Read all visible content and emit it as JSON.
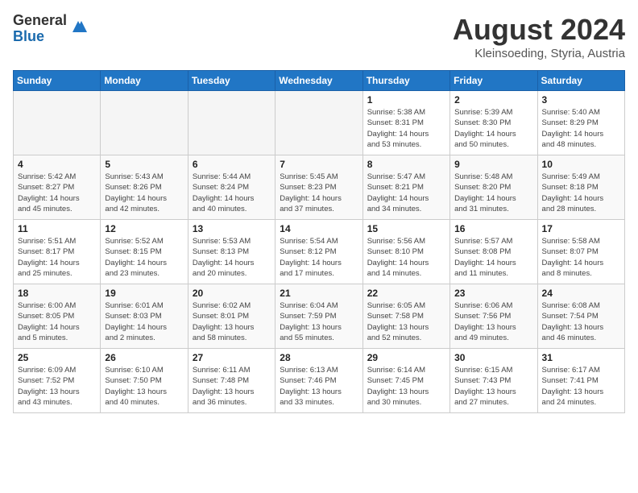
{
  "header": {
    "logo_line1": "General",
    "logo_line2": "Blue",
    "month_title": "August 2024",
    "location": "Kleinsoeding, Styria, Austria"
  },
  "days_of_week": [
    "Sunday",
    "Monday",
    "Tuesday",
    "Wednesday",
    "Thursday",
    "Friday",
    "Saturday"
  ],
  "weeks": [
    [
      {
        "day": "",
        "info": ""
      },
      {
        "day": "",
        "info": ""
      },
      {
        "day": "",
        "info": ""
      },
      {
        "day": "",
        "info": ""
      },
      {
        "day": "1",
        "info": "Sunrise: 5:38 AM\nSunset: 8:31 PM\nDaylight: 14 hours\nand 53 minutes."
      },
      {
        "day": "2",
        "info": "Sunrise: 5:39 AM\nSunset: 8:30 PM\nDaylight: 14 hours\nand 50 minutes."
      },
      {
        "day": "3",
        "info": "Sunrise: 5:40 AM\nSunset: 8:29 PM\nDaylight: 14 hours\nand 48 minutes."
      }
    ],
    [
      {
        "day": "4",
        "info": "Sunrise: 5:42 AM\nSunset: 8:27 PM\nDaylight: 14 hours\nand 45 minutes."
      },
      {
        "day": "5",
        "info": "Sunrise: 5:43 AM\nSunset: 8:26 PM\nDaylight: 14 hours\nand 42 minutes."
      },
      {
        "day": "6",
        "info": "Sunrise: 5:44 AM\nSunset: 8:24 PM\nDaylight: 14 hours\nand 40 minutes."
      },
      {
        "day": "7",
        "info": "Sunrise: 5:45 AM\nSunset: 8:23 PM\nDaylight: 14 hours\nand 37 minutes."
      },
      {
        "day": "8",
        "info": "Sunrise: 5:47 AM\nSunset: 8:21 PM\nDaylight: 14 hours\nand 34 minutes."
      },
      {
        "day": "9",
        "info": "Sunrise: 5:48 AM\nSunset: 8:20 PM\nDaylight: 14 hours\nand 31 minutes."
      },
      {
        "day": "10",
        "info": "Sunrise: 5:49 AM\nSunset: 8:18 PM\nDaylight: 14 hours\nand 28 minutes."
      }
    ],
    [
      {
        "day": "11",
        "info": "Sunrise: 5:51 AM\nSunset: 8:17 PM\nDaylight: 14 hours\nand 25 minutes."
      },
      {
        "day": "12",
        "info": "Sunrise: 5:52 AM\nSunset: 8:15 PM\nDaylight: 14 hours\nand 23 minutes."
      },
      {
        "day": "13",
        "info": "Sunrise: 5:53 AM\nSunset: 8:13 PM\nDaylight: 14 hours\nand 20 minutes."
      },
      {
        "day": "14",
        "info": "Sunrise: 5:54 AM\nSunset: 8:12 PM\nDaylight: 14 hours\nand 17 minutes."
      },
      {
        "day": "15",
        "info": "Sunrise: 5:56 AM\nSunset: 8:10 PM\nDaylight: 14 hours\nand 14 minutes."
      },
      {
        "day": "16",
        "info": "Sunrise: 5:57 AM\nSunset: 8:08 PM\nDaylight: 14 hours\nand 11 minutes."
      },
      {
        "day": "17",
        "info": "Sunrise: 5:58 AM\nSunset: 8:07 PM\nDaylight: 14 hours\nand 8 minutes."
      }
    ],
    [
      {
        "day": "18",
        "info": "Sunrise: 6:00 AM\nSunset: 8:05 PM\nDaylight: 14 hours\nand 5 minutes."
      },
      {
        "day": "19",
        "info": "Sunrise: 6:01 AM\nSunset: 8:03 PM\nDaylight: 14 hours\nand 2 minutes."
      },
      {
        "day": "20",
        "info": "Sunrise: 6:02 AM\nSunset: 8:01 PM\nDaylight: 13 hours\nand 58 minutes."
      },
      {
        "day": "21",
        "info": "Sunrise: 6:04 AM\nSunset: 7:59 PM\nDaylight: 13 hours\nand 55 minutes."
      },
      {
        "day": "22",
        "info": "Sunrise: 6:05 AM\nSunset: 7:58 PM\nDaylight: 13 hours\nand 52 minutes."
      },
      {
        "day": "23",
        "info": "Sunrise: 6:06 AM\nSunset: 7:56 PM\nDaylight: 13 hours\nand 49 minutes."
      },
      {
        "day": "24",
        "info": "Sunrise: 6:08 AM\nSunset: 7:54 PM\nDaylight: 13 hours\nand 46 minutes."
      }
    ],
    [
      {
        "day": "25",
        "info": "Sunrise: 6:09 AM\nSunset: 7:52 PM\nDaylight: 13 hours\nand 43 minutes."
      },
      {
        "day": "26",
        "info": "Sunrise: 6:10 AM\nSunset: 7:50 PM\nDaylight: 13 hours\nand 40 minutes."
      },
      {
        "day": "27",
        "info": "Sunrise: 6:11 AM\nSunset: 7:48 PM\nDaylight: 13 hours\nand 36 minutes."
      },
      {
        "day": "28",
        "info": "Sunrise: 6:13 AM\nSunset: 7:46 PM\nDaylight: 13 hours\nand 33 minutes."
      },
      {
        "day": "29",
        "info": "Sunrise: 6:14 AM\nSunset: 7:45 PM\nDaylight: 13 hours\nand 30 minutes."
      },
      {
        "day": "30",
        "info": "Sunrise: 6:15 AM\nSunset: 7:43 PM\nDaylight: 13 hours\nand 27 minutes."
      },
      {
        "day": "31",
        "info": "Sunrise: 6:17 AM\nSunset: 7:41 PM\nDaylight: 13 hours\nand 24 minutes."
      }
    ]
  ]
}
